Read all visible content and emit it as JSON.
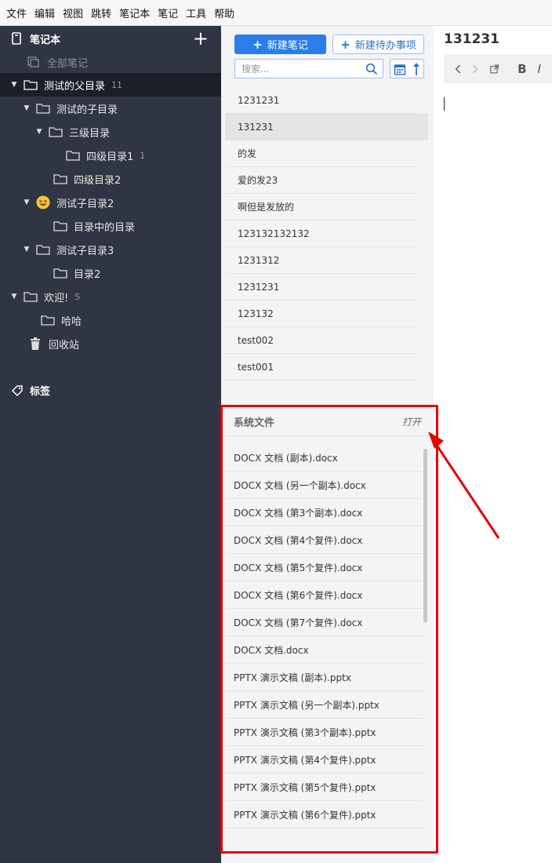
{
  "menu": [
    "文件",
    "编辑",
    "视图",
    "跳转",
    "笔记本",
    "笔记",
    "工具",
    "帮助"
  ],
  "sidebar": {
    "header": "笔记本",
    "all_notes": "全部笔记",
    "tree": [
      {
        "label": "测试的父目录",
        "count": "11"
      },
      {
        "label": "测试的子目录",
        "count": ""
      },
      {
        "label": "三级目录",
        "count": ""
      },
      {
        "label": "四级目录1",
        "count": "1"
      },
      {
        "label": "四级目录2",
        "count": ""
      },
      {
        "label": "测试子目录2",
        "count": ""
      },
      {
        "label": "目录中的目录",
        "count": ""
      },
      {
        "label": "测试子目录3",
        "count": ""
      },
      {
        "label": "目录2",
        "count": ""
      },
      {
        "label": "欢迎!",
        "count": "5"
      },
      {
        "label": "哈哈",
        "count": ""
      },
      {
        "label": "回收站",
        "count": ""
      }
    ],
    "tags": "标签"
  },
  "toolbar": {
    "new_note": "新建笔记",
    "new_todo": "新建待办事项",
    "search_placeholder": "搜索..."
  },
  "notes": [
    "1231231",
    "131231",
    "的发",
    "爱的发23",
    "啊但是发放的",
    "123132132132",
    "1231312",
    "1231231",
    "123132",
    "test002",
    "test001"
  ],
  "system_files": {
    "title": "系统文件",
    "open": "打开",
    "items": [
      "DOCX 文档 (副本).docx",
      "DOCX 文档 (另一个副本).docx",
      "DOCX 文档 (第3个副本).docx",
      "DOCX 文档 (第4个复件).docx",
      "DOCX 文档 (第5个复件).docx",
      "DOCX 文档 (第6个复件).docx",
      "DOCX 文档 (第7个复件).docx",
      "DOCX 文档.docx",
      "PPTX 演示文稿 (副本).pptx",
      "PPTX 演示文稿 (另一个副本).pptx",
      "PPTX 演示文稿 (第3个副本).pptx",
      "PPTX 演示文稿 (第4个复件).pptx",
      "PPTX 演示文稿 (第5个复件).pptx",
      "PPTX 演示文稿 (第6个复件).pptx"
    ]
  },
  "editor": {
    "title": "131231",
    "bold": "B",
    "italic": "I"
  },
  "colors": {
    "sidebar_bg": "#2f3542",
    "accent": "#2b7de9",
    "highlight": "#e50000"
  }
}
